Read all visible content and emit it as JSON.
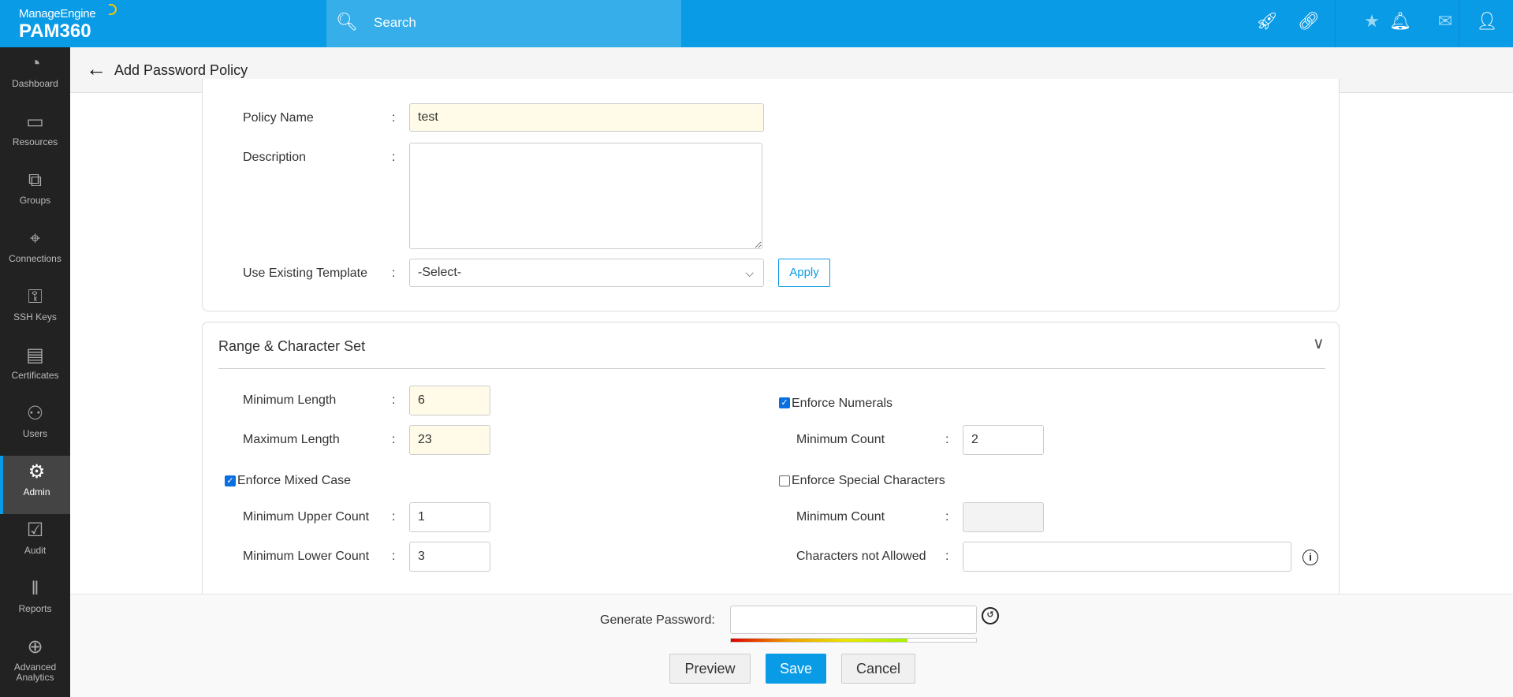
{
  "header": {
    "brand_top": "ManageEngine",
    "brand_product": "PAM360",
    "search_placeholder": "Search",
    "icons": [
      "rocket-icon",
      "link-icon",
      "user-star-icon",
      "bell-icon",
      "mail-icon",
      "user-icon"
    ],
    "accent_color": "#0a9be6"
  },
  "sidebar": {
    "items": [
      {
        "label": "Dashboard",
        "icon": "dashboard-icon"
      },
      {
        "label": "Resources",
        "icon": "monitor-icon"
      },
      {
        "label": "Groups",
        "icon": "groups-icon"
      },
      {
        "label": "Connections",
        "icon": "connections-icon"
      },
      {
        "label": "SSH Keys",
        "icon": "ssh-key-icon"
      },
      {
        "label": "Certificates",
        "icon": "certificate-icon"
      },
      {
        "label": "Users",
        "icon": "user-icon"
      },
      {
        "label": "Admin",
        "icon": "gear-icon",
        "active": true
      },
      {
        "label": "Audit",
        "icon": "clipboard-check-icon"
      },
      {
        "label": "Reports",
        "icon": "bar-chart-icon"
      },
      {
        "label": "Advanced Analytics",
        "icon": "analytics-icon"
      }
    ]
  },
  "page": {
    "title": "Add Password Policy"
  },
  "general": {
    "policy_name_label": "Policy Name",
    "policy_name_value": "test",
    "description_label": "Description",
    "description_value": "",
    "template_label": "Use Existing Template",
    "template_value": "-Select-",
    "apply_label": "Apply",
    "colon": ":"
  },
  "range": {
    "title": "Range & Character Set",
    "min_length_label": "Minimum Length",
    "min_length_value": "6",
    "max_length_label": "Maximum Length",
    "max_length_value": "23",
    "mixed_case_label": "Enforce Mixed Case",
    "mixed_case_checked": true,
    "min_upper_label": "Minimum Upper Count",
    "min_upper_value": "1",
    "min_lower_label": "Minimum Lower Count",
    "min_lower_value": "3",
    "numerals_label": "Enforce Numerals",
    "numerals_checked": true,
    "numerals_min_label": "Minimum Count",
    "numerals_min_value": "2",
    "special_label": "Enforce Special Characters",
    "special_checked": false,
    "special_min_label": "Minimum Count",
    "special_min_value": "",
    "not_allowed_label": "Characters not Allowed",
    "not_allowed_value": ""
  },
  "footer": {
    "generate_label": "Generate Password:",
    "generate_value": "",
    "strength_percent": 72,
    "preview_label": "Preview",
    "save_label": "Save",
    "cancel_label": "Cancel"
  }
}
